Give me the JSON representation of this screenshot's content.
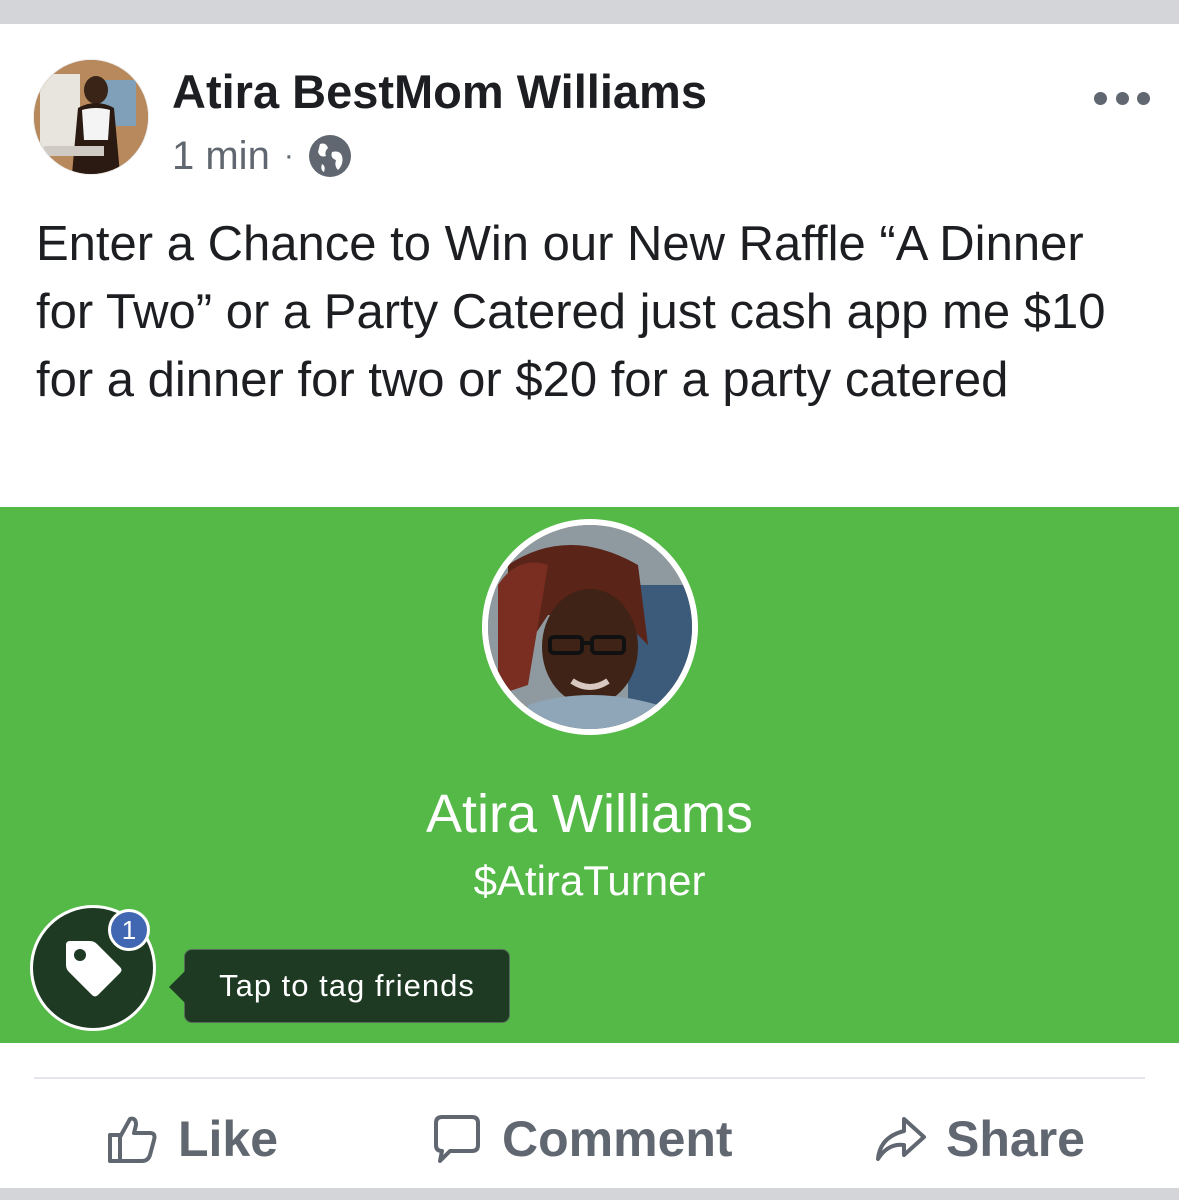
{
  "post": {
    "author": "Atira BestMom Williams",
    "timestamp": "1 min",
    "separator": "·",
    "privacy_icon": "globe-icon",
    "more_icon": "more-options-icon",
    "text": "Enter a Chance to Win our New Raffle “A Dinner for Two” or a Party Catered just cash app me $10 for a dinner for two or $20 for a party catered"
  },
  "attachment": {
    "background_color": "#54b947",
    "display_name": "Atira Williams",
    "cashtag": "$AtiraTurner",
    "tag_badge_count": "1",
    "tag_tooltip": "Tap to tag friends",
    "tag_icon": "tag-icon"
  },
  "actions": {
    "like_label": "Like",
    "comment_label": "Comment",
    "share_label": "Share"
  },
  "colors": {
    "text_primary": "#1c1e21",
    "text_secondary": "#606770",
    "badge": "#4267b2",
    "tooltip_bg": "#1e3a22"
  }
}
